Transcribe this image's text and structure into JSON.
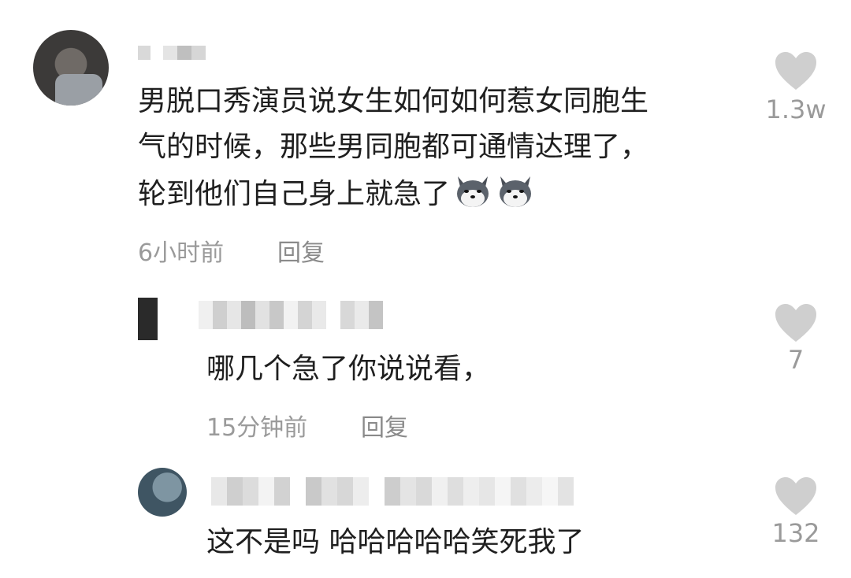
{
  "comments": [
    {
      "text_lines": [
        "男脱口秀演员说女生如何如何惹女同胞生",
        "气的时候，那些男同胞都可通情达理了，",
        "轮到他们自己身上就急了"
      ],
      "emoji_icon": "husky-dog-face-icon",
      "time": "6小时前",
      "reply_label": "回复",
      "likes": "1.3w"
    }
  ],
  "replies": [
    {
      "text": "哪几个急了你说说看，",
      "time": "15分钟前",
      "reply_label": "回复",
      "likes": "7"
    },
    {
      "text": "这不是吗 哈哈哈哈哈笑死我了",
      "likes": "132"
    }
  ],
  "colors": {
    "heart": "#cfcfcf",
    "meta": "#9a9a9a",
    "text": "#1f1f1f"
  }
}
